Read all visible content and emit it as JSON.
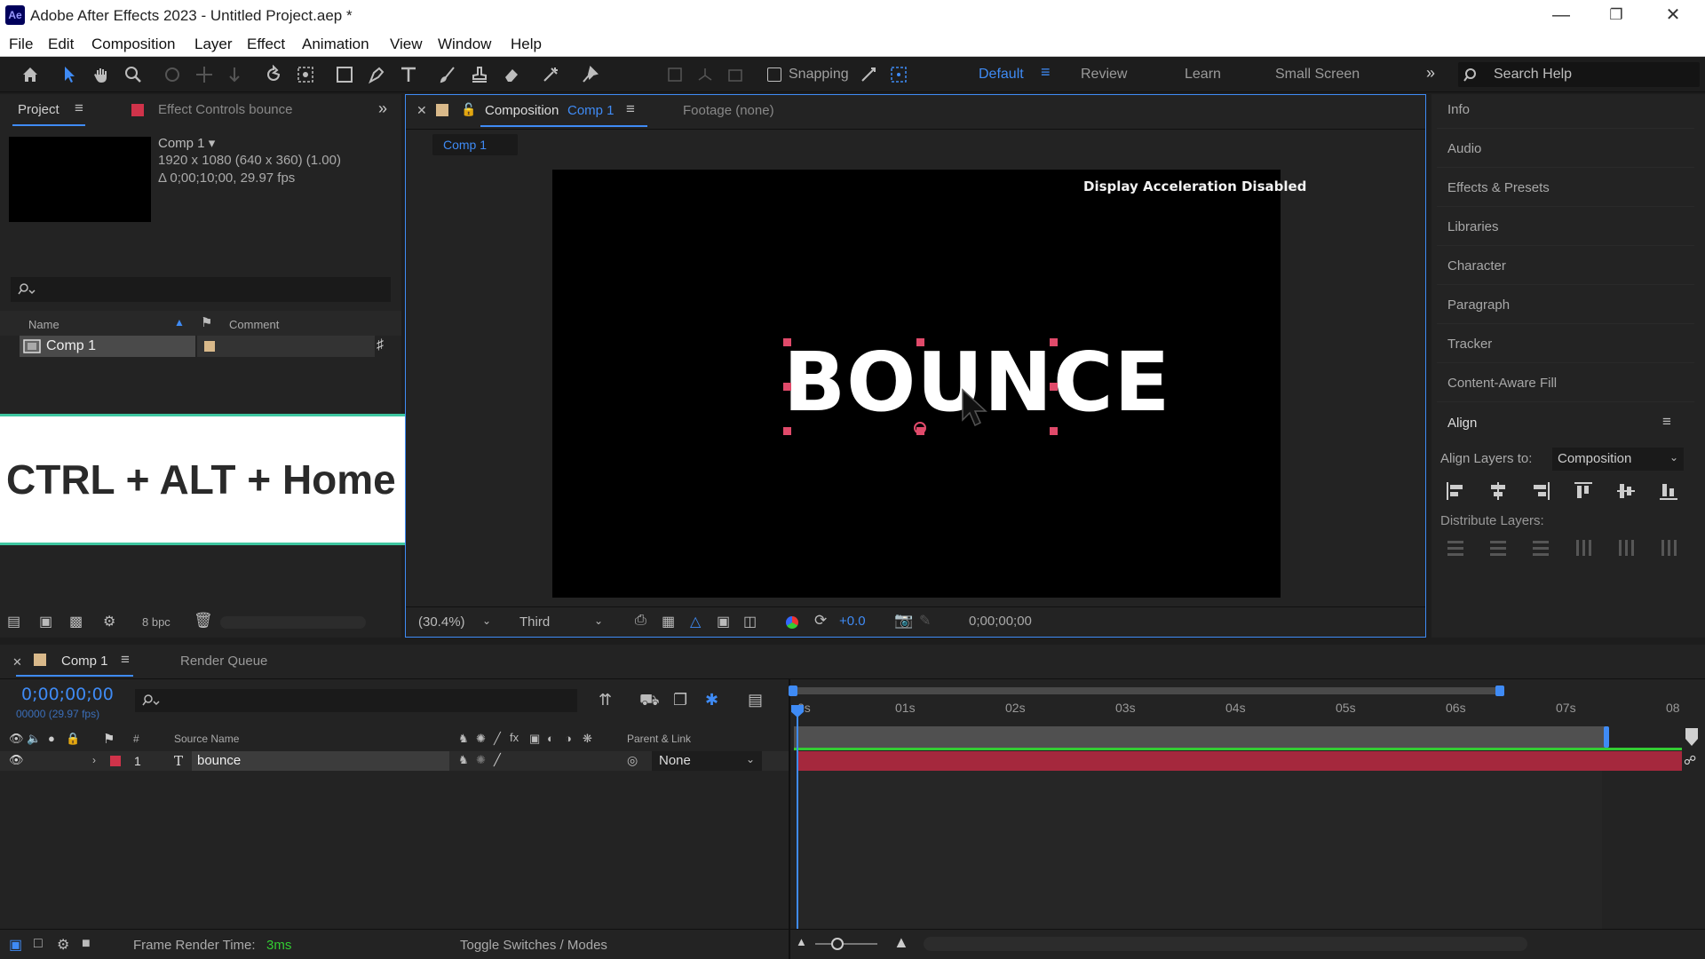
{
  "app": {
    "icon_label": "Ae",
    "title": "Adobe After Effects 2023 - Untitled Project.aep *",
    "window_controls": [
      "minimize-icon",
      "restore-icon",
      "close-icon"
    ]
  },
  "menu": [
    "File",
    "Edit",
    "Composition",
    "Layer",
    "Effect",
    "Animation",
    "View",
    "Window",
    "Help"
  ],
  "toolbar": {
    "snapping_label": "Snapping",
    "workspaces": [
      "Default",
      "Review",
      "Learn",
      "Small Screen"
    ],
    "active_workspace": "Default",
    "search_placeholder": "Search Help"
  },
  "project_panel": {
    "tab_label": "Project",
    "effect_controls_label": "Effect Controls bounce",
    "comp_name": "Comp 1 ▾",
    "comp_info_1": "1920 x 1080  (640 x 360) (1.00)",
    "comp_info_2": "Δ 0;00;10;00, 29.97 fps",
    "col_name": "Name",
    "col_comment": "Comment",
    "item_name": "Comp 1",
    "bpc": "8 bpc"
  },
  "overlay": {
    "shortcut": "CTRL + ALT + Home"
  },
  "composition_panel": {
    "tab_prefix": "Composition",
    "tab_comp": "Comp 1",
    "footage_tab": "Footage  (none)",
    "breadcrumb": "Comp 1",
    "accel_notice": "Display Acceleration Disabled",
    "canvas_text": "BOUNCE",
    "zoom": "(30.4%)",
    "resolution": "Third",
    "exposure": "+0.0",
    "timecode": "0;00;00;00"
  },
  "right_panels": [
    "Info",
    "Audio",
    "Effects & Presets",
    "Libraries",
    "Character",
    "Paragraph",
    "Tracker",
    "Content-Aware Fill"
  ],
  "align_panel": {
    "title": "Align",
    "align_to_label": "Align Layers to:",
    "align_to_value": "Composition",
    "distribute_label": "Distribute Layers:"
  },
  "timeline": {
    "tab_comp": "Comp 1",
    "render_queue": "Render Queue",
    "current_time": "0;00;00;00",
    "frame_info": "00000 (29.97 fps)",
    "col_source_name": "Source Name",
    "col_parent": "Parent & Link",
    "layer_index": "1",
    "layer_type": "T",
    "layer_name": "bounce",
    "parent_value": "None",
    "ruler": [
      "0s",
      "01s",
      "02s",
      "03s",
      "04s",
      "05s",
      "06s",
      "07s",
      "08"
    ],
    "frame_render_label": "Frame Render Time:",
    "frame_render_value": "3ms",
    "toggle_label": "Toggle Switches / Modes"
  },
  "colors": {
    "accent": "#3f8bf5",
    "layer_label": "#d0334a",
    "layer_bar": "#a5283d",
    "overlay_border": "#3ec6a0",
    "handle": "#e04a6a"
  }
}
